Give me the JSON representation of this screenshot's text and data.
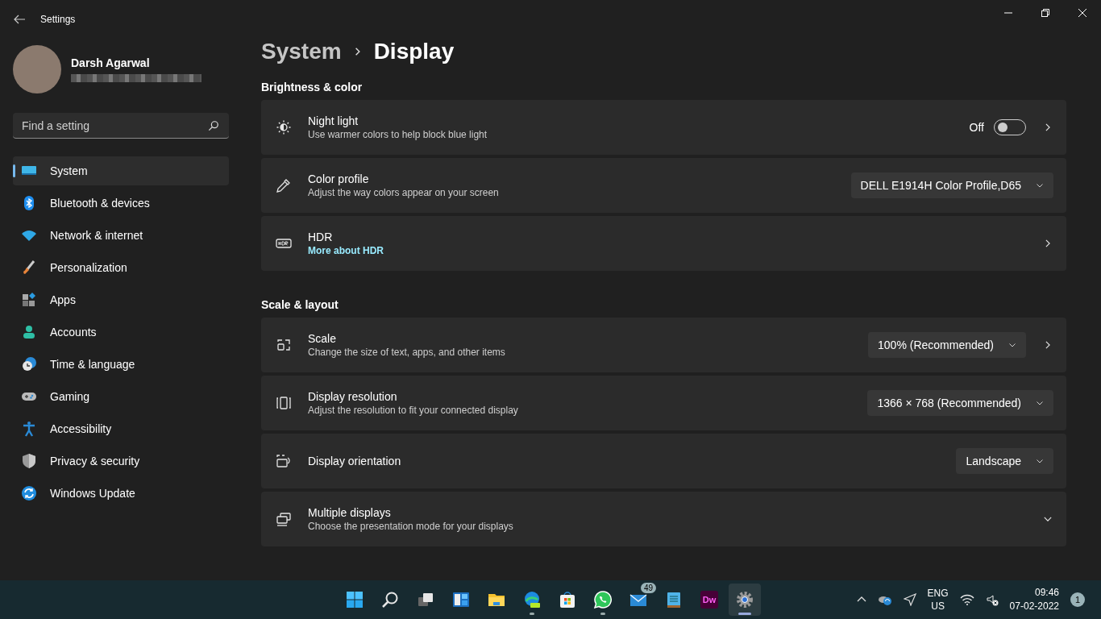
{
  "window": {
    "title": "Settings"
  },
  "user": {
    "name": "Darsh Agarwal"
  },
  "search": {
    "placeholder": "Find a setting"
  },
  "nav": [
    {
      "label": "System",
      "selected": true
    },
    {
      "label": "Bluetooth & devices",
      "selected": false
    },
    {
      "label": "Network & internet",
      "selected": false
    },
    {
      "label": "Personalization",
      "selected": false
    },
    {
      "label": "Apps",
      "selected": false
    },
    {
      "label": "Accounts",
      "selected": false
    },
    {
      "label": "Time & language",
      "selected": false
    },
    {
      "label": "Gaming",
      "selected": false
    },
    {
      "label": "Accessibility",
      "selected": false
    },
    {
      "label": "Privacy & security",
      "selected": false
    },
    {
      "label": "Windows Update",
      "selected": false
    }
  ],
  "breadcrumb": {
    "parent": "System",
    "current": "Display"
  },
  "sections": [
    {
      "heading": "Brightness & color",
      "rows": [
        {
          "title": "Night light",
          "subtitle": "Use warmer colors to help block blue light",
          "toggle": {
            "label": "Off",
            "on": false
          },
          "chevron": true
        },
        {
          "title": "Color profile",
          "subtitle": "Adjust the way colors appear on your screen",
          "dropdown": "DELL E1914H Color Profile,D65"
        },
        {
          "title": "HDR",
          "link": "More about HDR",
          "chevron": true
        }
      ]
    },
    {
      "heading": "Scale & layout",
      "rows": [
        {
          "title": "Scale",
          "subtitle": "Change the size of text, apps, and other items",
          "dropdown": "100% (Recommended)",
          "chevron": true
        },
        {
          "title": "Display resolution",
          "subtitle": "Adjust the resolution to fit your connected display",
          "dropdown": "1366 × 768 (Recommended)"
        },
        {
          "title": "Display orientation",
          "dropdown": "Landscape"
        },
        {
          "title": "Multiple displays",
          "subtitle": "Choose the presentation mode for your displays",
          "expanded": false
        }
      ]
    }
  ],
  "taskbar": {
    "apps": [
      {
        "running": false,
        "selected": false
      },
      {
        "running": false,
        "selected": false
      },
      {
        "running": false,
        "selected": false
      },
      {
        "running": false,
        "selected": false
      },
      {
        "running": false,
        "selected": false
      },
      {
        "running": true,
        "selected": false
      },
      {
        "running": false,
        "selected": false
      },
      {
        "running": true,
        "selected": false
      },
      {
        "running": false,
        "selected": false,
        "badge": "49"
      },
      {
        "running": false,
        "selected": false
      },
      {
        "running": false,
        "selected": false,
        "label": "Dw"
      },
      {
        "running": true,
        "selected": true
      }
    ],
    "language": [
      "ENG",
      "US"
    ],
    "time": "09:46",
    "date": "07-02-2022",
    "notifications": "1"
  }
}
